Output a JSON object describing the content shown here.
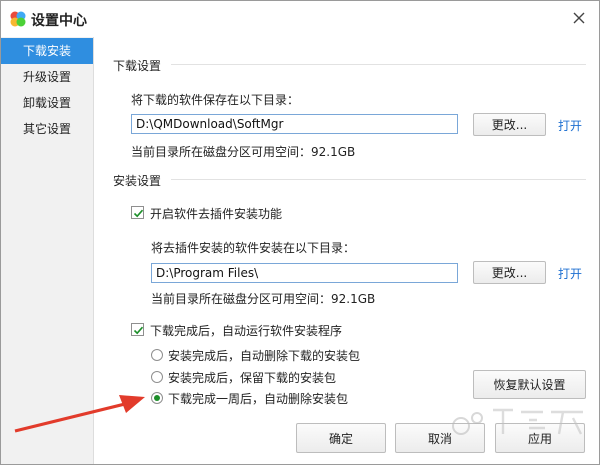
{
  "window": {
    "title": "设置中心"
  },
  "sidebar": {
    "items": [
      {
        "label": "下载安装",
        "active": true
      },
      {
        "label": "升级设置",
        "active": false
      },
      {
        "label": "卸载设置",
        "active": false
      },
      {
        "label": "其它设置",
        "active": false
      }
    ]
  },
  "download": {
    "section_title": "下载设置",
    "path_label": "将下载的软件保存在以下目录：",
    "path_value": "D:\\QMDownload\\SoftMgr",
    "change_label": "更改...",
    "open_label": "打开",
    "free_space": "当前目录所在磁盘分区可用空间：92.1GB"
  },
  "install": {
    "section_title": "安装设置",
    "plugin_checkbox_label": "开启软件去插件安装功能",
    "plugin_checked": true,
    "plugin_path_label": "将去插件安装的软件安装在以下目录：",
    "plugin_path_value": "D:\\Program Files\\",
    "change_label": "更改...",
    "open_label": "打开",
    "free_space": "当前目录所在磁盘分区可用空间：92.1GB",
    "auto_install_label": "下载完成后，自动运行软件安装程序",
    "auto_install_checked": true,
    "radio_options": [
      {
        "label": "安装完成后，自动删除下载的安装包",
        "selected": false
      },
      {
        "label": "安装完成后，保留下载的安装包",
        "selected": false
      },
      {
        "label": "下载完成一周后，自动删除安装包",
        "selected": true
      }
    ],
    "restore_label": "恢复默认设置"
  },
  "footer": {
    "ok_label": "确定",
    "cancel_label": "取消",
    "apply_label": "应用"
  },
  "colors": {
    "accent": "#2f8ee0",
    "link": "#1d6fd1",
    "arrow": "#e23b2b",
    "radio_selected": "#1d8f2a"
  }
}
